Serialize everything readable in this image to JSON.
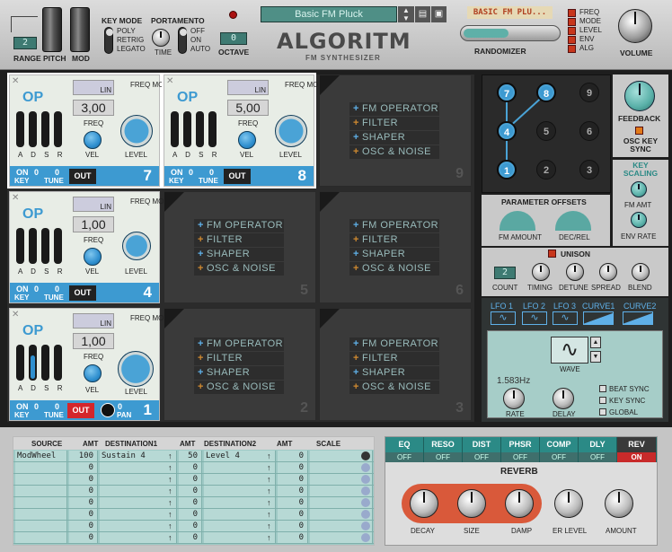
{
  "top": {
    "range_label": "RANGE",
    "range_value": "2",
    "pitch_label": "PITCH",
    "mod_label": "MOD",
    "key_mode_label": "KEY MODE",
    "key_modes": [
      "POLY",
      "RETRIG",
      "LEGATO"
    ],
    "portamento_label": "PORTAMENTO",
    "time_label": "TIME",
    "porta_modes": [
      "OFF",
      "ON",
      "AUTO"
    ],
    "octave_label": "OCTAVE",
    "octave_value": "0",
    "patch_name": "Basic FM Pluck",
    "title": "ALGORITM",
    "subtitle": "FM SYNTHESIZER",
    "randomizer_label": "RANDOMIZER",
    "randomizer_display": "BASIC FM PLU...",
    "rand_targets": [
      "FREQ",
      "MODE",
      "LEVEL",
      "ENV",
      "ALG"
    ],
    "volume_label": "VOLUME"
  },
  "operators": [
    {
      "slot": "7",
      "freq": "3,00",
      "out": "OUT",
      "key": "0",
      "tune": "0",
      "level": 0.55
    },
    {
      "slot": "8",
      "freq": "5,00",
      "out": "OUT",
      "key": "0",
      "tune": "0",
      "level": 0.55
    },
    {
      "slot": "4",
      "freq": "1,00",
      "out": "OUT",
      "key": "0",
      "tune": "0",
      "level": 0.4
    },
    {
      "slot": "1",
      "freq": "1,00",
      "out": "OUT",
      "key": "0",
      "tune": "0",
      "pan": "0",
      "level": 0.7
    }
  ],
  "op_labels": {
    "op": "OP",
    "lin": "LIN",
    "freq_mode": "FREQ MODE",
    "freq": "FREQ",
    "vel": "VEL",
    "level": "LEVEL",
    "a": "A",
    "d": "D",
    "s": "S",
    "r": "R",
    "on": "ON",
    "key": "KEY",
    "tune": "TUNE",
    "pan": "PAN"
  },
  "empty_slots": [
    {
      "slot": "9",
      "items": [
        "FM OPERATOR",
        "FILTER",
        "SHAPER",
        "OSC & NOISE"
      ]
    },
    {
      "slot": "5",
      "items": [
        "FM OPERATOR",
        "FILTER",
        "SHAPER",
        "OSC & NOISE"
      ]
    },
    {
      "slot": "6",
      "items": [
        "FM OPERATOR",
        "FILTER",
        "SHAPER",
        "OSC & NOISE"
      ]
    },
    {
      "slot": "2",
      "items": [
        "FM OPERATOR",
        "FILTER",
        "SHAPER",
        "OSC & NOISE"
      ]
    },
    {
      "slot": "3",
      "items": [
        "FM OPERATOR",
        "FILTER",
        "SHAPER",
        "OSC & NOISE"
      ]
    }
  ],
  "algo": {
    "nodes": [
      "7",
      "8",
      "9",
      "4",
      "5",
      "6",
      "1",
      "2",
      "3"
    ],
    "active": [
      "7",
      "8",
      "4",
      "1"
    ],
    "feedback": "FEEDBACK",
    "osc_key_sync": "OSC KEY SYNC",
    "key_scaling": "KEY SCALING",
    "fm_amt": "FM AMT",
    "env_rate": "ENV RATE",
    "param_offsets": "PARAMETER OFFSETS",
    "fm_amount": "FM AMOUNT",
    "dec_rel": "DEC/REL"
  },
  "unison": {
    "label": "UNISON",
    "count": "2",
    "count_label": "COUNT",
    "timing": "TIMING",
    "detune": "DETUNE",
    "spread": "SPREAD",
    "blend": "BLEND"
  },
  "lfo": {
    "tabs": [
      "LFO 1",
      "LFO 2",
      "LFO 3",
      "CURVE1",
      "CURVE2"
    ],
    "wave": "WAVE",
    "rate_value": "1.583Hz",
    "rate": "RATE",
    "delay": "DELAY",
    "beat_sync": "BEAT SYNC",
    "key_sync": "KEY SYNC",
    "global": "GLOBAL"
  },
  "mod_matrix": {
    "headers": [
      "SOURCE",
      "AMT",
      "DESTINATION1",
      "AMT",
      "DESTINATION2",
      "AMT",
      "SCALE"
    ],
    "rows": [
      [
        "ModWheel",
        "100",
        "Sustain 4",
        "50",
        "Level 4",
        "0",
        ""
      ],
      [
        "",
        "0",
        "",
        "0",
        "",
        "0",
        ""
      ],
      [
        "",
        "0",
        "",
        "0",
        "",
        "0",
        ""
      ],
      [
        "",
        "0",
        "",
        "0",
        "",
        "0",
        ""
      ],
      [
        "",
        "0",
        "",
        "0",
        "",
        "0",
        ""
      ],
      [
        "",
        "0",
        "",
        "0",
        "",
        "0",
        ""
      ],
      [
        "",
        "0",
        "",
        "0",
        "",
        "0",
        ""
      ],
      [
        "",
        "0",
        "",
        "0",
        "",
        "0",
        ""
      ]
    ]
  },
  "fx": {
    "tabs": [
      "EQ",
      "RESO",
      "DIST",
      "PHSR",
      "COMP",
      "DLY",
      "REV"
    ],
    "states": [
      "OFF",
      "OFF",
      "OFF",
      "OFF",
      "OFF",
      "OFF",
      "ON"
    ],
    "title": "REVERB",
    "knobs": [
      "DECAY",
      "SIZE",
      "DAMP",
      "ER LEVEL",
      "AMOUNT"
    ]
  }
}
